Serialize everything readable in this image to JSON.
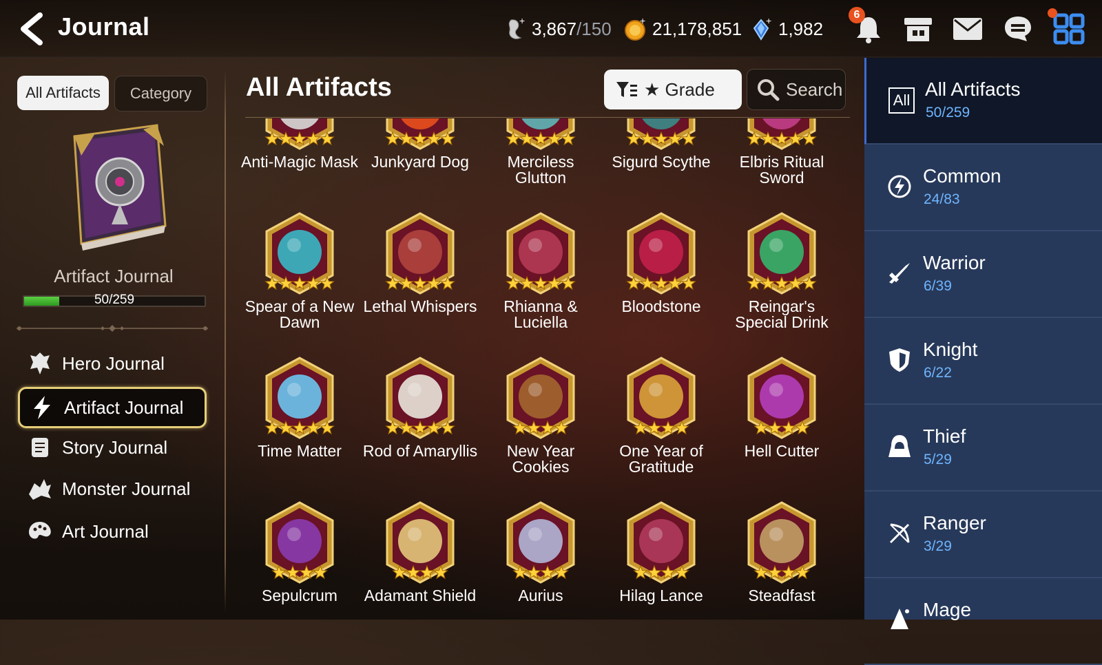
{
  "header": {
    "title": "Journal",
    "stamina": {
      "value": "3,867",
      "max": "/150",
      "icon": "stamina-icon"
    },
    "gold": {
      "value": "21,178,851",
      "icon": "gold-coin-icon"
    },
    "crystals": {
      "value": "1,982",
      "icon": "crystal-icon"
    },
    "notifications_count": "6",
    "icons": [
      "back-arrow-icon",
      "bell-icon",
      "shop-icon",
      "mail-icon",
      "chat-icon",
      "menu-grid-icon"
    ]
  },
  "left": {
    "tab_all": "All Artifacts",
    "tab_category": "Category",
    "journal_label": "Artifact Journal",
    "progress_text": "50/259",
    "progress_fraction": 0.193,
    "nav": [
      {
        "label": "Hero Journal",
        "icon": "hero-icon"
      },
      {
        "label": "Artifact Journal",
        "icon": "lightning-icon"
      },
      {
        "label": "Story Journal",
        "icon": "scroll-icon"
      },
      {
        "label": "Monster Journal",
        "icon": "monster-icon"
      },
      {
        "label": "Art Journal",
        "icon": "palette-icon"
      }
    ]
  },
  "main": {
    "title": "All Artifacts",
    "grade_label": "★ Grade",
    "search_label": "Search",
    "artifacts": [
      {
        "name": "Anti-Magic Mask",
        "line2": "",
        "stars": 5,
        "color": "#d9d9d9"
      },
      {
        "name": "Junkyard Dog",
        "line2": "",
        "stars": 5,
        "color": "#e8501c"
      },
      {
        "name": "Merciless",
        "line2": "Glutton",
        "stars": 5,
        "color": "#5fb7b8"
      },
      {
        "name": "Sigurd Scythe",
        "line2": "",
        "stars": 5,
        "color": "#3b8c8a"
      },
      {
        "name": "Elbris Ritual",
        "line2": "Sword",
        "stars": 5,
        "color": "#c23f88"
      },
      {
        "name": "Spear of a New",
        "line2": "Dawn",
        "stars": 5,
        "color": "#39b8c7"
      },
      {
        "name": "Lethal Whispers",
        "line2": "",
        "stars": 5,
        "color": "#b0443d"
      },
      {
        "name": "Rhianna &",
        "line2": "Luciella",
        "stars": 5,
        "color": "#b43a54"
      },
      {
        "name": "Bloodstone",
        "line2": "",
        "stars": 5,
        "color": "#c2204a"
      },
      {
        "name": "Reingar's",
        "line2": "Special Drink",
        "stars": 5,
        "color": "#35b56b"
      },
      {
        "name": "Time Matter",
        "line2": "",
        "stars": 5,
        "color": "#6cc5f0"
      },
      {
        "name": "Rod of Amaryllis",
        "line2": "",
        "stars": 5,
        "color": "#e9e6dc"
      },
      {
        "name": "New Year",
        "line2": "Cookies",
        "stars": 4,
        "color": "#a3662f"
      },
      {
        "name": "One Year of",
        "line2": "Gratitude",
        "stars": 4,
        "color": "#d9a33a"
      },
      {
        "name": "Hell Cutter",
        "line2": "",
        "stars": 4,
        "color": "#b43fbc"
      },
      {
        "name": "Sepulcrum",
        "line2": "",
        "stars": 4,
        "color": "#8a3cb0"
      },
      {
        "name": "Adamant Shield",
        "line2": "",
        "stars": 4,
        "color": "#e3c77a"
      },
      {
        "name": "Aurius",
        "line2": "",
        "stars": 4,
        "color": "#b3b6d8"
      },
      {
        "name": "Hilag Lance",
        "line2": "",
        "stars": 4,
        "color": "#b03b5c"
      },
      {
        "name": "Steadfast",
        "line2": "",
        "stars": 4,
        "color": "#c2a066"
      }
    ]
  },
  "categories": [
    {
      "name": "All Artifacts",
      "count": "50/259",
      "icon": "all-icon",
      "badge": "All"
    },
    {
      "name": "Common",
      "count": "24/83",
      "icon": "common-class-icon"
    },
    {
      "name": "Warrior",
      "count": "6/39",
      "icon": "warrior-class-icon"
    },
    {
      "name": "Knight",
      "count": "6/22",
      "icon": "knight-class-icon"
    },
    {
      "name": "Thief",
      "count": "5/29",
      "icon": "thief-class-icon"
    },
    {
      "name": "Ranger",
      "count": "3/29",
      "icon": "ranger-class-icon"
    },
    {
      "name": "Mage",
      "count": "",
      "icon": "mage-class-icon"
    }
  ]
}
